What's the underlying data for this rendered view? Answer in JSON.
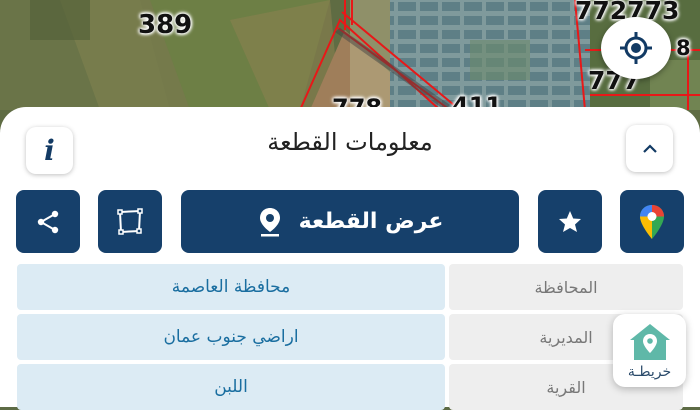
{
  "map": {
    "parcel_labels": [
      "389",
      "772773",
      "777",
      "8",
      "778",
      "411"
    ]
  },
  "controls": {
    "locate_icon": "crosshair-icon"
  },
  "panel": {
    "title": "معلومات القطعة",
    "info_icon": "info-icon",
    "collapse_icon": "chevron-up-icon",
    "actions": {
      "show_parcel_label": "عرض القطعة",
      "share_icon": "share-icon",
      "polygon_icon": "polygon-icon",
      "favorite_icon": "star-icon",
      "google_maps_icon": "google-maps-pin-icon",
      "location_pin_icon": "location-pin-icon"
    },
    "rows": [
      {
        "label": "المحافظة",
        "value": "محافظة العاصمة"
      },
      {
        "label": "المديرية",
        "value": "اراضي جنوب عمان"
      },
      {
        "label": "القرية",
        "value": "اللبن"
      }
    ]
  },
  "badge": {
    "text": "خريطـة",
    "icon": "house-pin-icon"
  },
  "colors": {
    "primary": "#16406b",
    "parcel_border": "#e81818",
    "value_bg": "#dcebf4",
    "value_text": "#1a6ea0",
    "label_bg": "#eeeeee"
  }
}
